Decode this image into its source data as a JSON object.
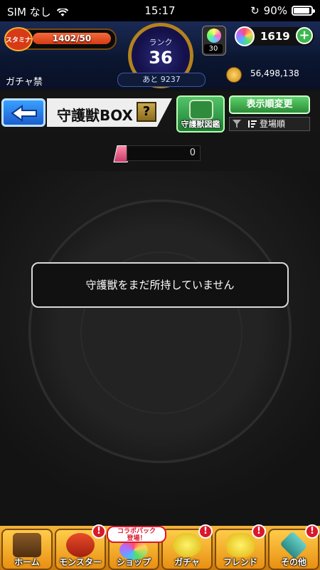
{
  "status_bar": {
    "carrier": "SIM なし",
    "time": "15:17",
    "battery": "90%"
  },
  "header": {
    "stamina_label": "スタミナ",
    "stamina_current": "1402",
    "stamina_max": "/50",
    "stamina_fill_fraction": 1.0,
    "rank_label": "ランク",
    "rank_value": "36",
    "rank_next": "あと 9237",
    "gem_count": "30",
    "orb_count": "1619",
    "gacha_ban": "ガチャ禁",
    "gold": "56,498,138"
  },
  "title_bar": {
    "title": "守護獣BOX",
    "help_label": "?",
    "zukan_label": "守護獣図鑑",
    "sort_label": "表示順変更",
    "sort_order": "登場順"
  },
  "counter": {
    "value": "0"
  },
  "main": {
    "empty_message": "守護獣をまだ所持していません"
  },
  "bottom_nav": {
    "items": [
      {
        "label": "ホーム",
        "icon": "home-icon",
        "badge": ""
      },
      {
        "label": "モンスター",
        "icon": "monster-icon",
        "badge": "!"
      },
      {
        "label": "ショップ",
        "icon": "shop-icon",
        "badge": ""
      },
      {
        "label": "ガチャ",
        "icon": "gacha-icon",
        "badge": "!"
      },
      {
        "label": "フレンド",
        "icon": "friend-icon",
        "badge": "!"
      },
      {
        "label": "その他",
        "icon": "other-icon",
        "badge": "!"
      }
    ],
    "collab_line1": "コラボパック",
    "collab_line2": "登場！"
  },
  "colors": {
    "accent_orange": "#e88f12",
    "header_blue": "#0b1630",
    "badge_red": "#d9182b",
    "button_green": "#3ab84a"
  }
}
